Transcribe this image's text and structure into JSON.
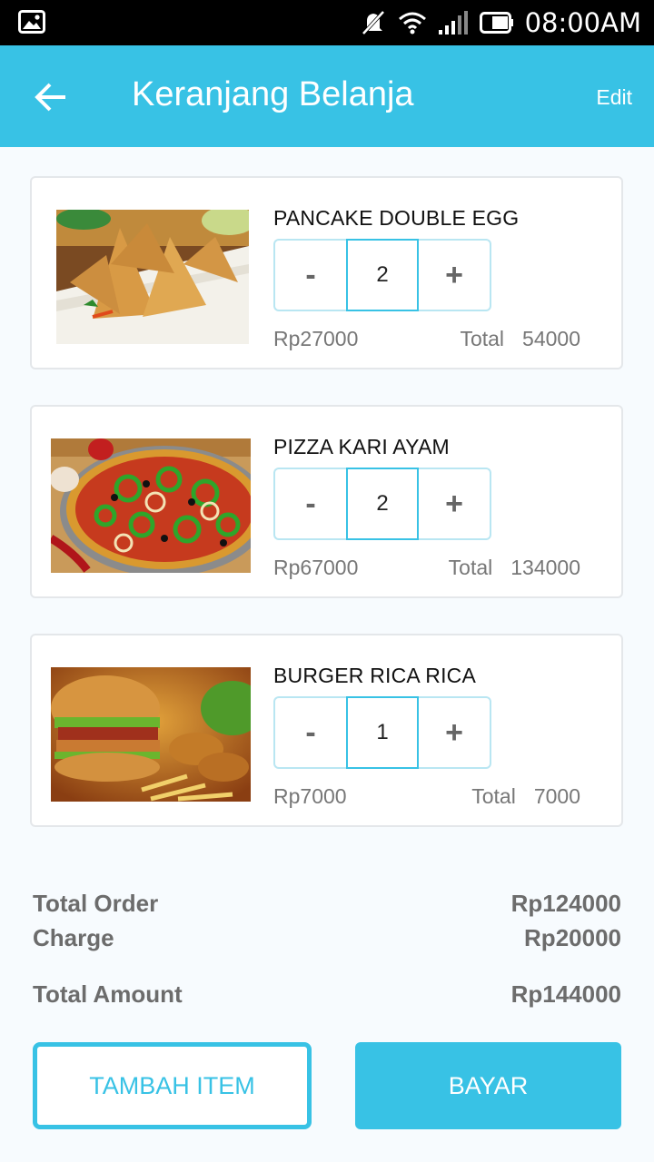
{
  "status_bar": {
    "time": "08:00AM",
    "icons": [
      "gallery-icon",
      "notifications-muted-icon",
      "wifi-icon",
      "signal-icon",
      "battery-icon"
    ]
  },
  "header": {
    "title": "Keranjang Belanja",
    "edit_label": "Edit",
    "back_icon": "arrow-left-icon",
    "color": "#38c2e5"
  },
  "cart": {
    "items": [
      {
        "name": "PANCAKE DOUBLE EGG",
        "price": "Rp27000",
        "quantity": "2",
        "total_label": "Total",
        "total": "54000",
        "image": "samosa-photo"
      },
      {
        "name": "PIZZA KARI AYAM",
        "price": "Rp67000",
        "quantity": "2",
        "total_label": "Total",
        "total": "134000",
        "image": "pizza-photo"
      },
      {
        "name": "BURGER RICA RICA",
        "price": "Rp7000",
        "quantity": "1",
        "total_label": "Total",
        "total": "7000",
        "image": "burger-photo"
      }
    ],
    "minus_label": "-",
    "plus_label": "+"
  },
  "summary": {
    "total_order_label": "Total Order",
    "total_order_value": "Rp124000",
    "charge_label": "Charge",
    "charge_value": "Rp20000",
    "total_amount_label": "Total Amount",
    "total_amount_value": "Rp144000"
  },
  "actions": {
    "add_item_label": "TAMBAH ITEM",
    "pay_label": "BAYAR"
  }
}
